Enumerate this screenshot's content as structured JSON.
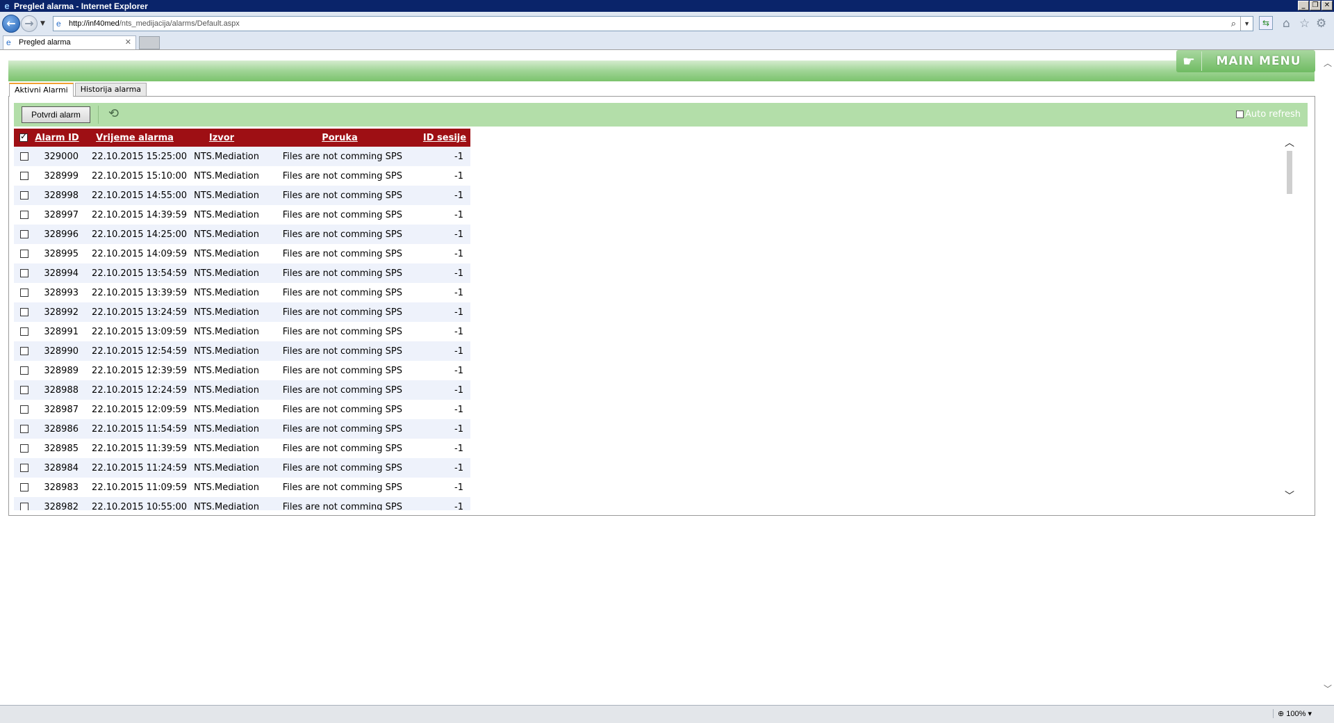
{
  "window": {
    "title": "Pregled alarma - Internet Explorer",
    "min": "_",
    "restore": "❐",
    "close": "✕"
  },
  "browser": {
    "url_host": "http://inf40med",
    "url_path": "/nts_medijacija/alarms/Default.aspx",
    "tab_title": "Pregled alarma",
    "tab_close": "✕",
    "zoom": "100%"
  },
  "header": {
    "main_menu_label": "MAIN MENU"
  },
  "page_tabs": [
    {
      "label": "Aktivni Alarmi",
      "active": true
    },
    {
      "label": "Historija alarma",
      "active": false
    }
  ],
  "toolbar": {
    "confirm_label": "Potvrdi alarm",
    "auto_refresh_label": "Auto refresh"
  },
  "grid": {
    "columns": [
      "Alarm ID",
      "Vrijeme alarma",
      "Izvor",
      "Poruka",
      "ID sesije"
    ],
    "rows": [
      {
        "id": "329000",
        "time": "22.10.2015 15:25:00",
        "source": "NTS.Mediation",
        "message": "Files are not comming SPS",
        "session": "-1"
      },
      {
        "id": "328999",
        "time": "22.10.2015 15:10:00",
        "source": "NTS.Mediation",
        "message": "Files are not comming SPS",
        "session": "-1"
      },
      {
        "id": "328998",
        "time": "22.10.2015 14:55:00",
        "source": "NTS.Mediation",
        "message": "Files are not comming SPS",
        "session": "-1"
      },
      {
        "id": "328997",
        "time": "22.10.2015 14:39:59",
        "source": "NTS.Mediation",
        "message": "Files are not comming SPS",
        "session": "-1"
      },
      {
        "id": "328996",
        "time": "22.10.2015 14:25:00",
        "source": "NTS.Mediation",
        "message": "Files are not comming SPS",
        "session": "-1"
      },
      {
        "id": "328995",
        "time": "22.10.2015 14:09:59",
        "source": "NTS.Mediation",
        "message": "Files are not comming SPS",
        "session": "-1"
      },
      {
        "id": "328994",
        "time": "22.10.2015 13:54:59",
        "source": "NTS.Mediation",
        "message": "Files are not comming SPS",
        "session": "-1"
      },
      {
        "id": "328993",
        "time": "22.10.2015 13:39:59",
        "source": "NTS.Mediation",
        "message": "Files are not comming SPS",
        "session": "-1"
      },
      {
        "id": "328992",
        "time": "22.10.2015 13:24:59",
        "source": "NTS.Mediation",
        "message": "Files are not comming SPS",
        "session": "-1"
      },
      {
        "id": "328991",
        "time": "22.10.2015 13:09:59",
        "source": "NTS.Mediation",
        "message": "Files are not comming SPS",
        "session": "-1"
      },
      {
        "id": "328990",
        "time": "22.10.2015 12:54:59",
        "source": "NTS.Mediation",
        "message": "Files are not comming SPS",
        "session": "-1"
      },
      {
        "id": "328989",
        "time": "22.10.2015 12:39:59",
        "source": "NTS.Mediation",
        "message": "Files are not comming SPS",
        "session": "-1"
      },
      {
        "id": "328988",
        "time": "22.10.2015 12:24:59",
        "source": "NTS.Mediation",
        "message": "Files are not comming SPS",
        "session": "-1"
      },
      {
        "id": "328987",
        "time": "22.10.2015 12:09:59",
        "source": "NTS.Mediation",
        "message": "Files are not comming SPS",
        "session": "-1"
      },
      {
        "id": "328986",
        "time": "22.10.2015 11:54:59",
        "source": "NTS.Mediation",
        "message": "Files are not comming SPS",
        "session": "-1"
      },
      {
        "id": "328985",
        "time": "22.10.2015 11:39:59",
        "source": "NTS.Mediation",
        "message": "Files are not comming SPS",
        "session": "-1"
      },
      {
        "id": "328984",
        "time": "22.10.2015 11:24:59",
        "source": "NTS.Mediation",
        "message": "Files are not comming SPS",
        "session": "-1"
      },
      {
        "id": "328983",
        "time": "22.10.2015 11:09:59",
        "source": "NTS.Mediation",
        "message": "Files are not comming SPS",
        "session": "-1"
      },
      {
        "id": "328982",
        "time": "22.10.2015 10:55:00",
        "source": "NTS.Mediation",
        "message": "Files are not comming SPS",
        "session": "-1"
      }
    ]
  },
  "colors": {
    "grid_header": "#9e0f14",
    "toolbar_bg": "#b3dea9",
    "row_alt": "#eef2fb"
  }
}
